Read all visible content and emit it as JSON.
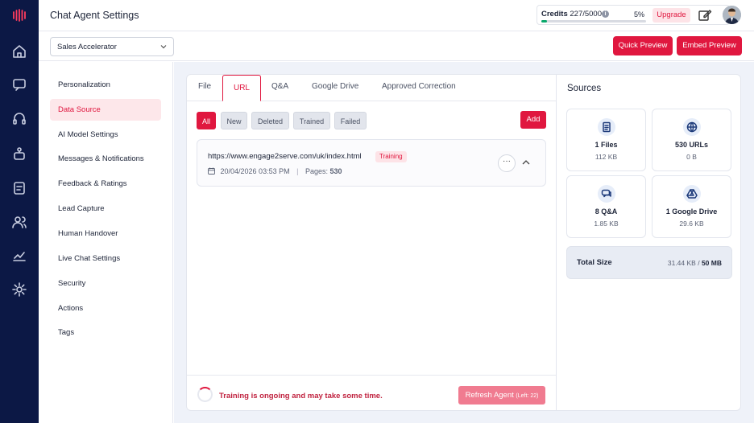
{
  "header": {
    "title": "Chat Agent Settings",
    "credits_label": "Credits",
    "credits_value": "227/5000",
    "credits_percent": "5%",
    "credits_fraction": 0.05,
    "upgrade_label": "Upgrade"
  },
  "subbar": {
    "agent_selected": "Sales Accelerator",
    "quick_preview": "Quick Preview",
    "embed_preview": "Embed Preview"
  },
  "menu": {
    "items": [
      "Personalization",
      "Data Source",
      "AI Model Settings",
      "Messages & Notifications",
      "Feedback & Ratings",
      "Lead Capture",
      "Human Handover",
      "Live Chat Settings",
      "Security",
      "Actions",
      "Tags"
    ],
    "active": "Data Source"
  },
  "tabs": [
    "File",
    "URL",
    "Q&A",
    "Google Drive",
    "Approved Correction"
  ],
  "filters": [
    "All",
    "New",
    "Deleted",
    "Trained",
    "Failed"
  ],
  "add_label": "Add",
  "url_item": {
    "url": "https://www.engage2serve.com/uk/index.html",
    "status": "Training",
    "date": "20/04/2026 03:53 PM",
    "separator": "|",
    "pages_label": "Pages:",
    "pages_value": "530"
  },
  "footer": {
    "message": "Training is ongoing and may take some time.",
    "refresh_label": "Refresh Agent",
    "refresh_left": "(Left: 22)"
  },
  "sources": {
    "title": "Sources",
    "tiles": [
      {
        "label": "1 Files",
        "size": "112 KB",
        "icon": "file-icon"
      },
      {
        "label": "530 URLs",
        "size": "0 B",
        "icon": "globe-icon"
      },
      {
        "label": "8 Q&A",
        "size": "1.85 KB",
        "icon": "chat-icon"
      },
      {
        "label": "1 Google Drive",
        "size": "29.6 KB",
        "icon": "drive-icon"
      }
    ],
    "total_label": "Total Size",
    "total_used": "31.44 KB",
    "total_sep": "/",
    "total_max": "50 MB"
  },
  "colors": {
    "accent": "#e0173f",
    "rail": "#0c1845",
    "progress": "#0aa86b"
  }
}
